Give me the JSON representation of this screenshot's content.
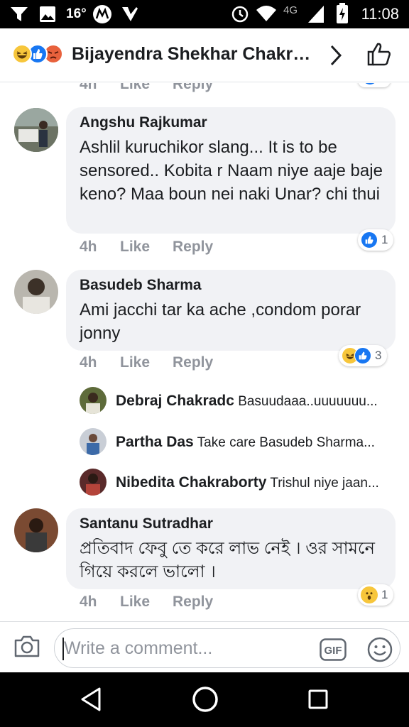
{
  "status_bar": {
    "temperature": "16°",
    "network": "4G",
    "time": "11:08"
  },
  "header": {
    "title": "Bijayendra Shekhar Chakraborty",
    "reactions": [
      "haha",
      "like",
      "angry"
    ]
  },
  "partial_row": {
    "time": "4h",
    "like": "Like",
    "reply": "Reply"
  },
  "comments": [
    {
      "author": "Angshu Rajkumar",
      "text": "Ashlil kuruchikor slang... It is to be sensored.. Kobita r Naam niye aaje baje keno? Maa boun nei naki Unar? chi thui",
      "time": "4h",
      "like": "Like",
      "reply": "Reply",
      "reactions": [
        "like"
      ],
      "reaction_count": "1"
    },
    {
      "author": "Basudeb Sharma",
      "text": "Ami jacchi tar ka ache ,condom porar jonny",
      "time": "4h",
      "like": "Like",
      "reply": "Reply",
      "reactions": [
        "haha",
        "like"
      ],
      "reaction_count": "3",
      "replies": [
        {
          "author": "Debraj Chakradc",
          "text": "Basuudaaa..uuuuuuu..."
        },
        {
          "author": "Partha Das",
          "text": "Take care Basudeb Sharma..."
        },
        {
          "author": "Nibedita Chakraborty",
          "text": "Trishul niye jaan..."
        }
      ]
    },
    {
      "author": "Santanu Sutradhar",
      "text": "প্রতিবাদ ফেবু তে করে লাভ নেই । ওর সামনে গিয়ে করলে ভালো ।",
      "time": "4h",
      "like": "Like",
      "reply": "Reply",
      "reactions": [
        "wow"
      ],
      "reaction_count": "1"
    }
  ],
  "composer": {
    "placeholder": "Write a comment...",
    "gif_label": "GIF"
  },
  "colors": {
    "like_blue": "#1877f2",
    "reaction_yellow": "#f7c63b",
    "angry_orange": "#e8613c",
    "bubble_grey": "#f1f2f5",
    "meta_grey": "#90949c"
  }
}
